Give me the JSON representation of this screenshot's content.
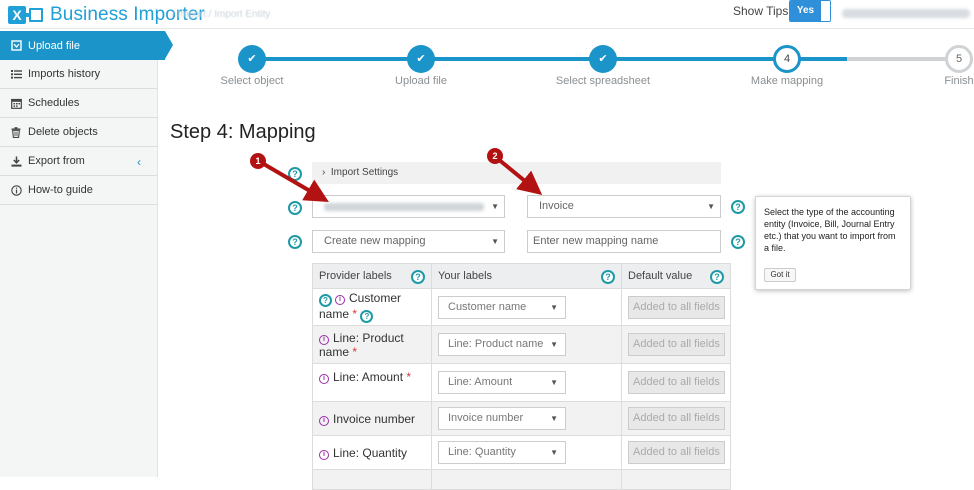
{
  "app": {
    "title": "Business Importer",
    "breadcrumb_blurred": "/ Import / Import Entity",
    "show_tips_label": "Show Tips",
    "show_tips_value": "Yes",
    "user_blurred": "customer.account@example.com"
  },
  "sidebar": {
    "items": [
      {
        "label": "Upload file",
        "icon": "file-upload-icon",
        "active": true
      },
      {
        "label": "Imports history",
        "icon": "list-icon"
      },
      {
        "label": "Schedules",
        "icon": "calendar-icon"
      },
      {
        "label": "Delete objects",
        "icon": "trash-icon"
      },
      {
        "label": "Export from",
        "icon": "download-icon"
      },
      {
        "label": "How-to guide",
        "icon": "info-icon"
      }
    ],
    "collapse_chevron": "‹"
  },
  "stepper": {
    "steps": [
      {
        "label": "Select object",
        "state": "done",
        "mark": "✔"
      },
      {
        "label": "Upload file",
        "state": "done",
        "mark": "✔"
      },
      {
        "label": "Select spreadsheet",
        "state": "done",
        "mark": "✔"
      },
      {
        "label": "Make mapping",
        "state": "current",
        "mark": "4"
      },
      {
        "label": "Finish",
        "state": "todo",
        "mark": "5"
      }
    ]
  },
  "page": {
    "title": "Step 4: Mapping"
  },
  "form": {
    "import_settings_label": "Import Settings",
    "company_select_blurred": "Demo Company Ltd",
    "entity_select": "Invoice",
    "mapping_select": "Create new mapping",
    "mapping_name_placeholder": "Enter new mapping name"
  },
  "markers": {
    "one": "1",
    "two": "2"
  },
  "tooltip": {
    "text": "Select the type of the accounting entity (Invoice, Bill, Journal Entry etc.) that you want to import from a file.",
    "button": "Got it"
  },
  "table": {
    "headers": {
      "provider": "Provider labels",
      "yours": "Your labels",
      "default": "Default value"
    },
    "rows": [
      {
        "label": "Customer name",
        "required": true,
        "your_label": "Customer name",
        "default": "Added to all fields"
      },
      {
        "label": "Line: Product name",
        "required": true,
        "your_label": "Line: Product name",
        "default": "Added to all fields"
      },
      {
        "label": "Line: Amount",
        "required": true,
        "your_label": "Line: Amount",
        "default": "Added to all fields"
      },
      {
        "label": "Invoice number",
        "required": false,
        "your_label": "Invoice number",
        "default": "Added to all fields"
      },
      {
        "label": "Line: Quantity",
        "required": false,
        "your_label": "Line: Quantity",
        "default": "Added to all fields"
      }
    ],
    "required_mark": "*"
  },
  "colors": {
    "brand": "#1fa0d6",
    "active_nav": "#1b94c9",
    "help_icon": "#1e9aa6",
    "info_icon": "#9b2fa8",
    "arrow_marker": "#b31212",
    "required": "#d43b3b"
  }
}
